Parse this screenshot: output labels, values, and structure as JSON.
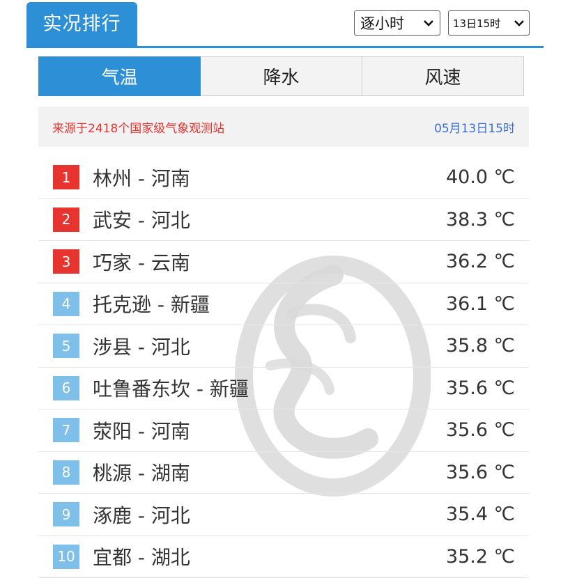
{
  "header": {
    "title": "实况排行",
    "interval_select": "逐小时",
    "time_select": "13日15时"
  },
  "tabs": [
    {
      "label": "气温",
      "active": true
    },
    {
      "label": "降水",
      "active": false
    },
    {
      "label": "风速",
      "active": false
    }
  ],
  "source": {
    "text": "来源于2418个国家级气象观测站",
    "time": "05月13日15时"
  },
  "rows": [
    {
      "rank": "1",
      "place": "林州 - 河南",
      "temp": "40.0 ℃"
    },
    {
      "rank": "2",
      "place": "武安 - 河北",
      "temp": "38.3 ℃"
    },
    {
      "rank": "3",
      "place": "巧家 - 云南",
      "temp": "36.2 ℃"
    },
    {
      "rank": "4",
      "place": "托克逊 - 新疆",
      "temp": "36.1 ℃"
    },
    {
      "rank": "5",
      "place": "涉县 - 河北",
      "temp": "35.8 ℃"
    },
    {
      "rank": "6",
      "place": "吐鲁番东坎 - 新疆",
      "temp": "35.6 ℃"
    },
    {
      "rank": "7",
      "place": "荥阳 - 河南",
      "temp": "35.6 ℃"
    },
    {
      "rank": "8",
      "place": "桃源 - 湖南",
      "temp": "35.6 ℃"
    },
    {
      "rank": "9",
      "place": "涿鹿 - 河北",
      "temp": "35.4 ℃"
    },
    {
      "rank": "10",
      "place": "宜都 - 湖北",
      "temp": "35.2 ℃"
    }
  ],
  "colors": {
    "accent": "#2d8fd6",
    "rank_top": "#e8342e",
    "rank_rest": "#7ec0ea",
    "source_text": "#e8342e",
    "source_time": "#3a6fd8"
  },
  "icons": {
    "dropdown": "chevron-down-icon",
    "watermark": "watermark-logo"
  }
}
